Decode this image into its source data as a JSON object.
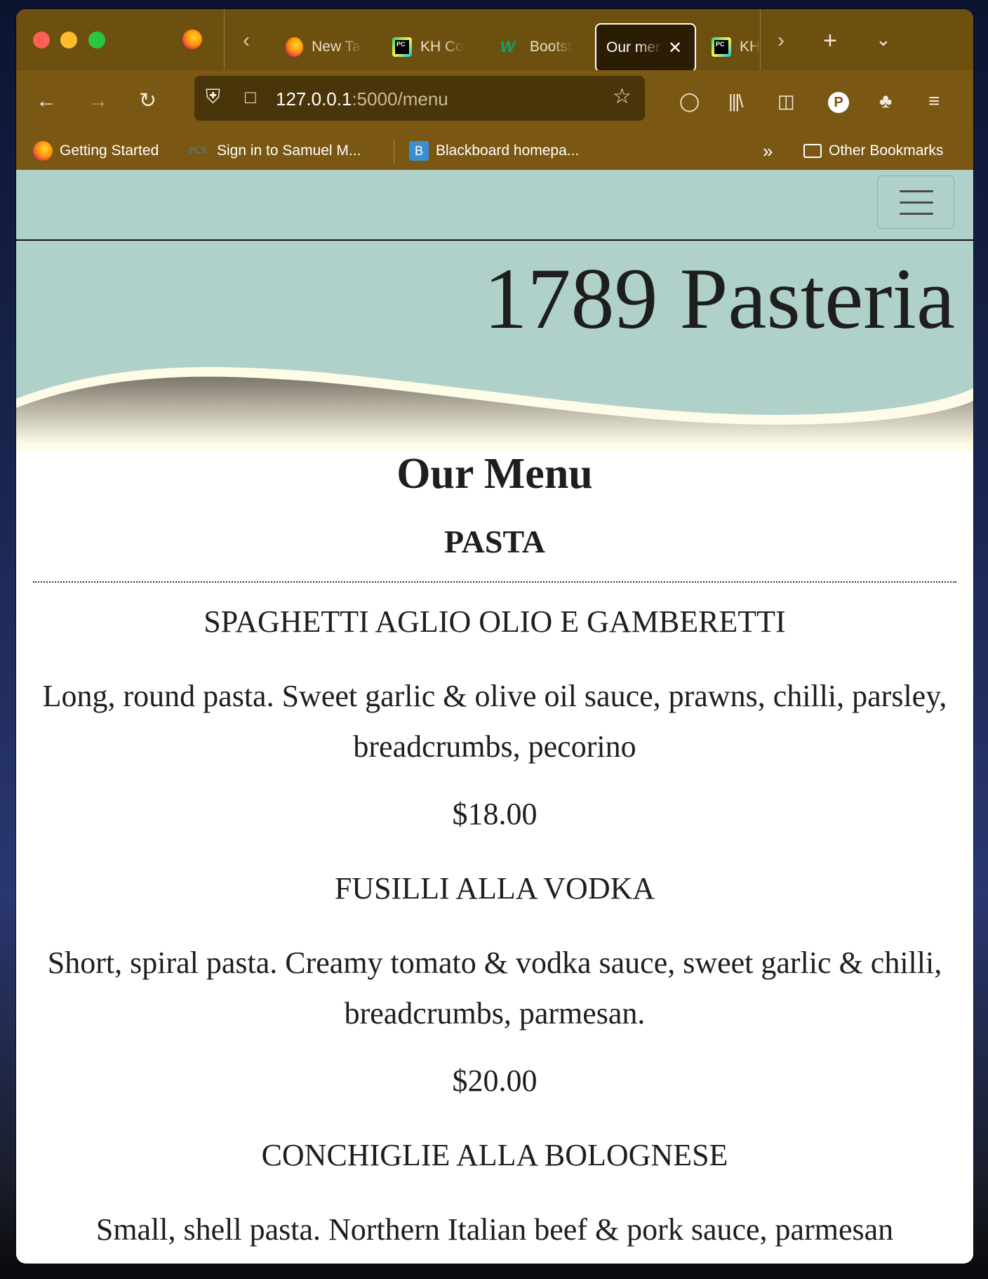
{
  "browser": {
    "tabs": [
      {
        "label": "New Tab"
      },
      {
        "label": "KH Co"
      },
      {
        "label": "Bootst"
      },
      {
        "label": "Our menu",
        "active": true
      },
      {
        "label": "KH"
      }
    ],
    "url_host": "127.0.0.1",
    "url_path": ":5000/menu",
    "profile_initial": "P",
    "bookmarks": [
      {
        "label": "Getting Started"
      },
      {
        "label": "Sign in to Samuel M..."
      },
      {
        "label": "Blackboard homepa..."
      }
    ],
    "other_bookmarks": "Other Bookmarks",
    "accent_color": "#7a5712"
  },
  "site": {
    "title": "1789 Pasteria",
    "navbar_color": "#b0d0ca",
    "menu_heading": "Our Menu",
    "section": "PASTA",
    "items": [
      {
        "name": "SPAGHETTI AGLIO OLIO E GAMBERETTI",
        "description": "Long, round pasta. Sweet garlic & olive oil sauce, prawns, chilli, parsley, breadcrumbs, pecorino",
        "price": "$18.00"
      },
      {
        "name": "FUSILLI ALLA VODKA",
        "description": "Short, spiral pasta. Creamy tomato & vodka sauce, sweet garlic & chilli, breadcrumbs, parmesan.",
        "price": "$20.00"
      },
      {
        "name": "CONCHIGLIE ALLA BOLOGNESE",
        "description": "Small, shell pasta. Northern Italian beef & pork sauce, parmesan"
      }
    ]
  }
}
